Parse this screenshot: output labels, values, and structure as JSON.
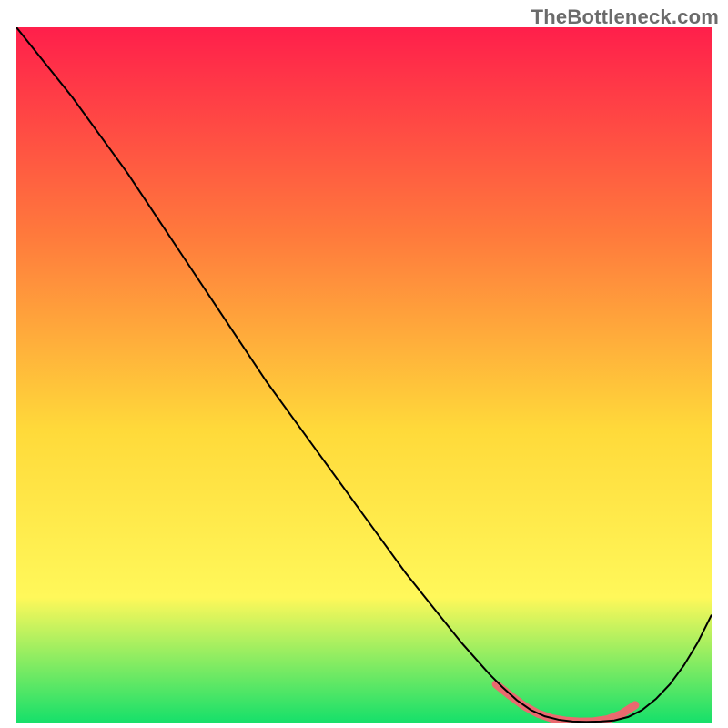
{
  "watermark": "TheBottleneck.com",
  "chart_data": {
    "type": "line",
    "title": "",
    "xlabel": "",
    "ylabel": "",
    "xlim": [
      0,
      100
    ],
    "ylim": [
      0,
      100
    ],
    "grid": false,
    "legend": false,
    "background_gradient": {
      "top": "#ff1f4b",
      "upper_mid": "#ff7a3c",
      "mid": "#ffda3a",
      "lower_mid": "#fff85a",
      "bottom": "#16e06a"
    },
    "series": [
      {
        "name": "bottleneck-curve",
        "color": "#000000",
        "stroke_width": 2,
        "x": [
          0,
          4,
          8,
          12,
          16,
          20,
          24,
          28,
          32,
          36,
          40,
          44,
          48,
          52,
          56,
          60,
          64,
          68,
          70,
          72,
          74,
          76,
          78,
          80,
          82,
          84,
          86,
          88,
          90,
          92,
          94,
          96,
          98,
          100
        ],
        "y": [
          100,
          95,
          90,
          84.5,
          79,
          73,
          67,
          61,
          55,
          49,
          43.5,
          38,
          32.5,
          27,
          21.5,
          16.5,
          11.5,
          7,
          5,
          3.2,
          1.8,
          0.9,
          0.4,
          0.15,
          0.1,
          0.15,
          0.3,
          0.8,
          1.8,
          3.4,
          5.5,
          8.2,
          11.5,
          15.5
        ]
      },
      {
        "name": "highlight-trough",
        "color": "#ea6a6f",
        "stroke_width": 9,
        "linecap": "round",
        "x": [
          69,
          71,
          73,
          75,
          77,
          79,
          81,
          83,
          85,
          87,
          89
        ],
        "y": [
          5.5,
          3.9,
          2.4,
          1.3,
          0.6,
          0.25,
          0.12,
          0.15,
          0.45,
          1.2,
          2.5
        ]
      }
    ]
  }
}
